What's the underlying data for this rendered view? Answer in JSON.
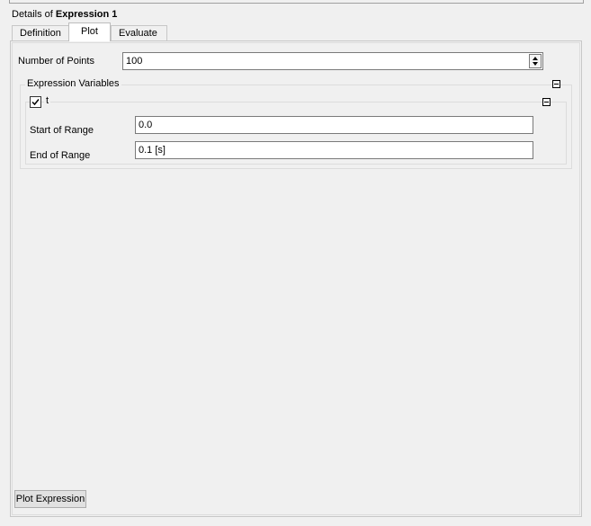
{
  "details": {
    "prefix": "Details of",
    "name": "Expression 1"
  },
  "tabs": [
    {
      "label": "Definition",
      "active": false
    },
    {
      "label": "Plot",
      "active": true
    },
    {
      "label": "Evaluate",
      "active": false
    }
  ],
  "plot": {
    "num_points": {
      "label": "Number of Points",
      "value": "100"
    },
    "expression_variables": {
      "legend": "Expression Variables",
      "collapse_icon": "minus-box-icon",
      "variable": {
        "name": "t",
        "checked": true,
        "start": {
          "label": "Start of Range",
          "value": "0.0"
        },
        "end": {
          "label": "End of Range",
          "value": "0.1 [s]"
        }
      }
    },
    "plot_button": "Plot Expression"
  }
}
